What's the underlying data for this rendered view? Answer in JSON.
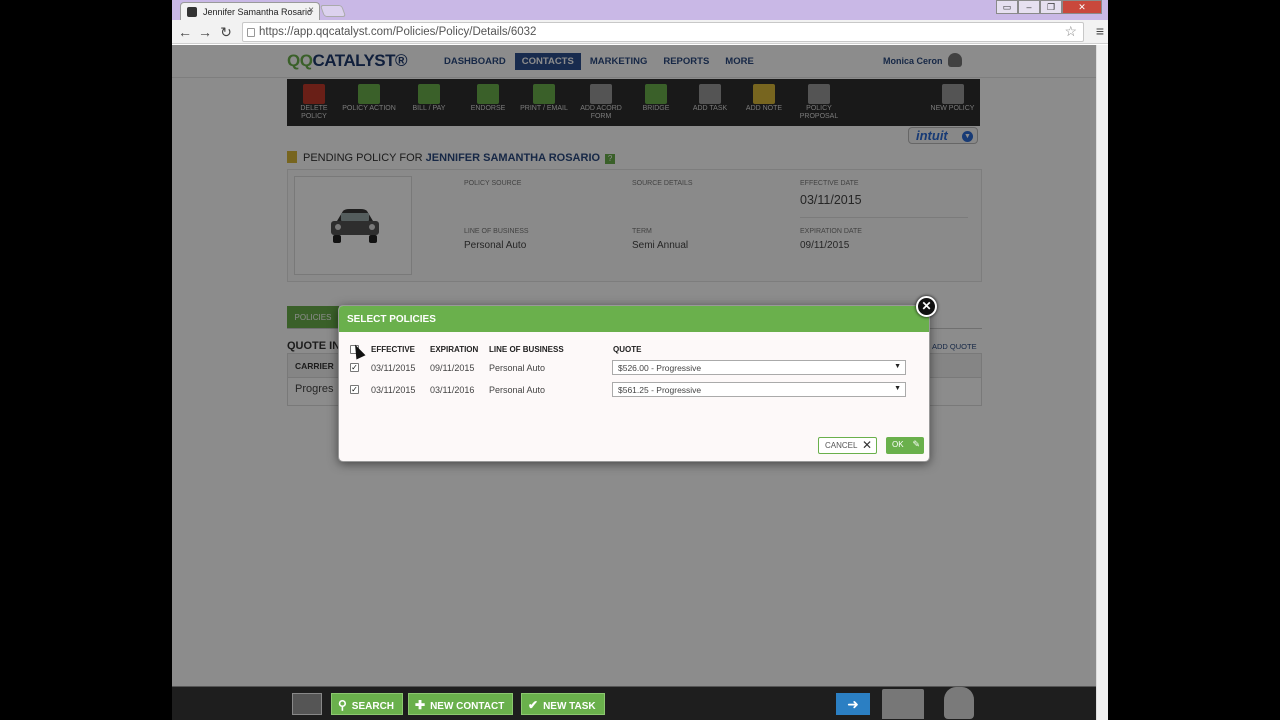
{
  "browser": {
    "tab_title": "Jennifer Samantha Rosario",
    "tab_close": "×",
    "url": "https://app.qqcatalyst.com/Policies/Policy/Details/6032"
  },
  "header": {
    "logo_qq": "QQ",
    "logo_rest": "CATALYST®",
    "nav": [
      "DASHBOARD",
      "CONTACTS",
      "MARKETING",
      "REPORTS",
      "MORE"
    ],
    "active_nav": "CONTACTS",
    "user_name": "Monica Ceron"
  },
  "ribbon": [
    {
      "label": "DELETE POLICY",
      "icon": "delete-policy-icon",
      "color": "#c0392b"
    },
    {
      "label": "POLICY ACTION",
      "icon": "policy-action-icon",
      "color": "#6ab04c"
    },
    {
      "label": "BILL / PAY",
      "icon": "bill-pay-icon",
      "color": "#6ab04c"
    },
    {
      "label": "ENDORSE",
      "icon": "endorse-icon",
      "color": "#6ab04c"
    },
    {
      "label": "PRINT / EMAIL",
      "icon": "print-email-icon",
      "color": "#6ab04c"
    },
    {
      "label": "ADD ACORD FORM",
      "icon": "add-acord-form-icon",
      "color": "#9a9a9a"
    },
    {
      "label": "BRIDGE",
      "icon": "bridge-icon",
      "color": "#6ab04c"
    },
    {
      "label": "ADD TASK",
      "icon": "add-task-icon",
      "color": "#9a9a9a"
    },
    {
      "label": "ADD NOTE",
      "icon": "add-note-icon",
      "color": "#d9b93a"
    },
    {
      "label": "POLICY PROPOSAL",
      "icon": "policy-proposal-icon",
      "color": "#9a9a9a"
    },
    {
      "label": "NEW POLICY",
      "icon": "new-policy-icon",
      "color": "#9a9a9a"
    }
  ],
  "intuit": {
    "label": "intuit"
  },
  "policy": {
    "title_prefix": "PENDING POLICY FOR",
    "insured_name": "JENNIFER SAMANTHA ROSARIO",
    "help": "?",
    "policy_source_label": "POLICY SOURCE",
    "source_details_label": "SOURCE DETAILS",
    "effective_date_label": "EFFECTIVE DATE",
    "effective_date": "03/11/2015",
    "line_of_business_label": "LINE OF BUSINESS",
    "line_of_business": "Personal Auto",
    "term_label": "TERM",
    "term": "Semi Annual",
    "expiration_date_label": "EXPIRATION DATE",
    "expiration_date": "09/11/2015"
  },
  "tabs": {
    "policies": "POLICIES"
  },
  "quotes": {
    "heading": "QUOTE IN",
    "add_quote": "ADD QUOTE",
    "col_carrier": "CARRIER",
    "row_carrier": "Progres"
  },
  "modal": {
    "title": "SELECT POLICIES",
    "close": "✕",
    "columns": [
      "EFFECTIVE",
      "EXPIRATION",
      "LINE OF BUSINESS",
      "QUOTE"
    ],
    "rows": [
      {
        "checked": true,
        "effective": "03/11/2015",
        "expiration": "09/11/2015",
        "line_of_business": "Personal Auto",
        "quote": "$526.00 - Progressive"
      },
      {
        "checked": true,
        "effective": "03/11/2015",
        "expiration": "03/11/2016",
        "line_of_business": "Personal Auto",
        "quote": "$561.25 - Progressive"
      }
    ],
    "cancel_label": "CANCEL",
    "ok_label": "OK"
  },
  "bottom_bar": {
    "search": "SEARCH",
    "new_contact": "NEW CONTACT",
    "new_task": "NEW TASK"
  },
  "colors": {
    "brand_green": "#6ab04c",
    "brand_blue": "#2c4f8e",
    "ribbon_bg": "#2f2f2f"
  }
}
